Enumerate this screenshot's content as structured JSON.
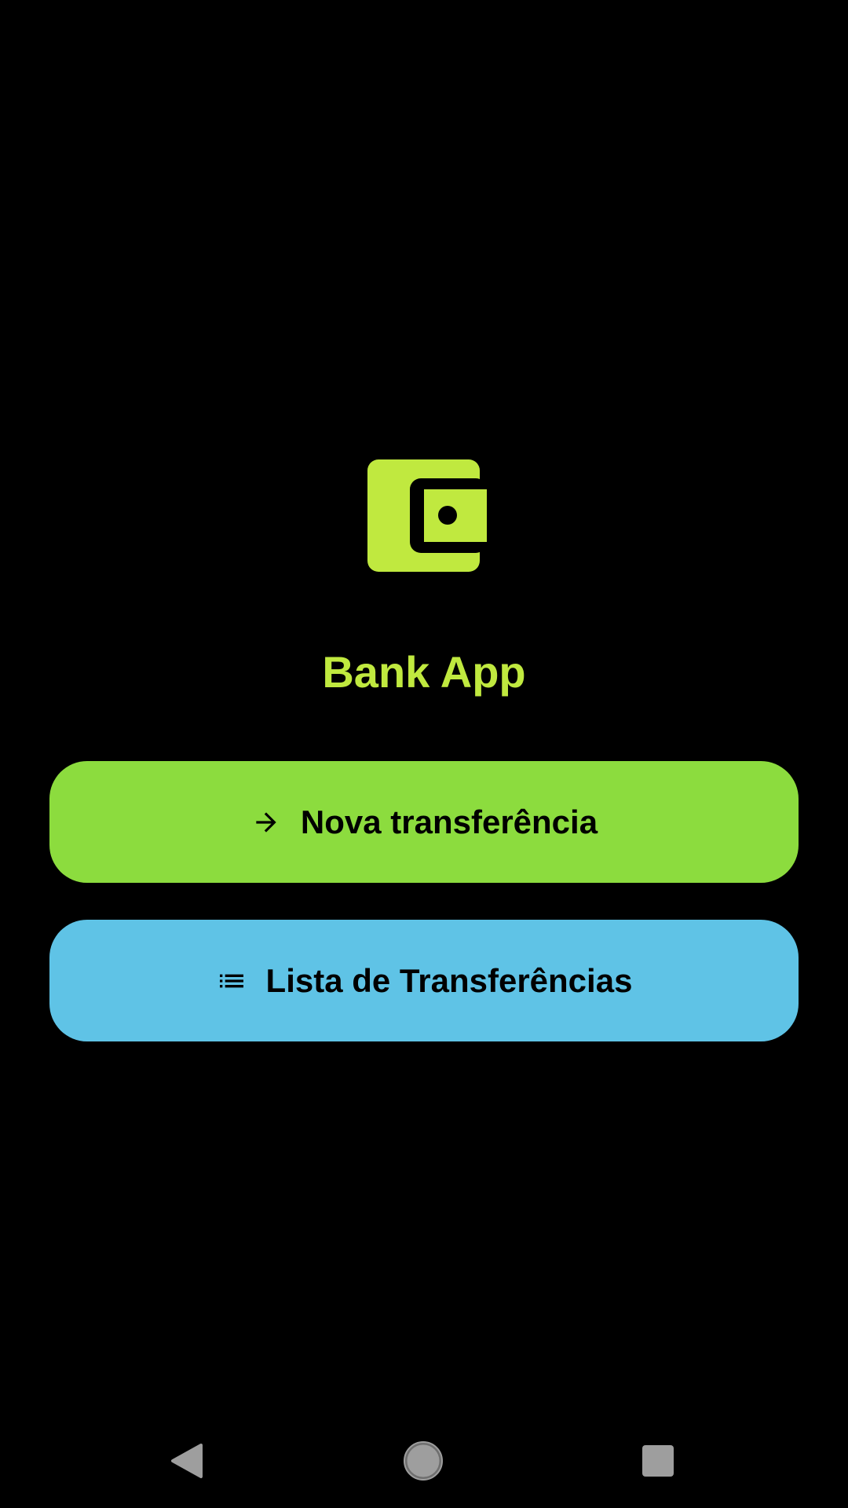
{
  "app": {
    "title": "Bank App",
    "logo_icon": "wallet-icon",
    "accent_color": "#c0e93f"
  },
  "actions": {
    "new_transfer": {
      "label": "Nova transferência",
      "icon": "arrow-right-icon",
      "color": "#8cdc3e"
    },
    "transfer_list": {
      "label": "Lista de Transferências",
      "icon": "list-icon",
      "color": "#5fc3e6"
    }
  },
  "system_nav": {
    "back_icon": "back-triangle-icon",
    "home_icon": "home-circle-icon",
    "recents_icon": "recents-square-icon"
  }
}
